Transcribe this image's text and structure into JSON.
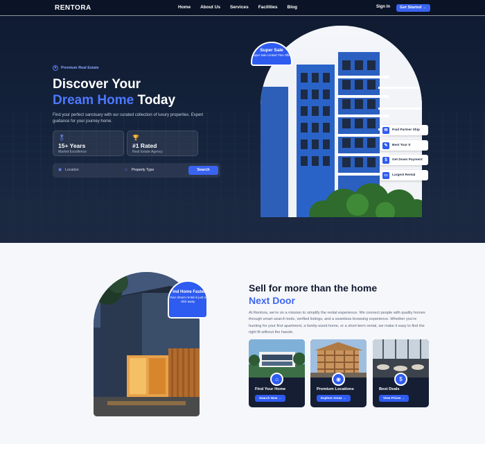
{
  "nav": {
    "logo": "RENTORA",
    "links": [
      "Home",
      "About Us",
      "Services",
      "Facilities",
      "Blog"
    ],
    "sign_in": "Sign In",
    "get_started": "Get Started →"
  },
  "hero": {
    "badge": "Premium Real Estate",
    "title_line1": "Discover Your",
    "title_blue": "Dream Home",
    "title_rest": " Today",
    "description": "Find your perfect sanctuary with our curated collection of luxury properties. Expert guidance for your journey home.",
    "stats": [
      {
        "value": "15+ Years",
        "label": "Market Excellence",
        "icon": "medal-icon"
      },
      {
        "value": "#1 Rated",
        "label": "Real Estate Agency",
        "icon": "trophy-icon"
      }
    ],
    "search": {
      "location_placeholder": "Location",
      "type_placeholder": "Property Type",
      "button": "Search"
    },
    "super_sale": {
      "title": "Super Sale",
      "subtitle": "Super Sale Limited Time Offer"
    },
    "features": [
      "Paid Partner Ship",
      "Best Tour It",
      "Get Down Payment",
      "Largest Rental"
    ]
  },
  "about": {
    "bubble_title": "Find Home Faster",
    "bubble_text": "Your dream rental is just a click away",
    "heading_line1": "Sell for more than the home",
    "heading_blue": "Next Door",
    "paragraph": "At Rentora, we’re on a mission to simplify the rental experience. We connect people with quality homes through smart search tools, verified listings, and a seamless browsing experience. Whether you’re hunting for your first apartment, a family-sized home, or a short-term rental, we make it easy to find the right fit without the hassle.",
    "cards": [
      {
        "title": "Find Your Home",
        "button": "Search Now →",
        "icon": "home-icon"
      },
      {
        "title": "Premium Locations",
        "button": "Explore Areas →",
        "icon": "location-pin-icon"
      },
      {
        "title": "Best Deals",
        "button": "View Prices →",
        "icon": "dollar-icon"
      }
    ]
  },
  "colors": {
    "accent": "#3a63f0",
    "dark": "#0f1a30"
  }
}
